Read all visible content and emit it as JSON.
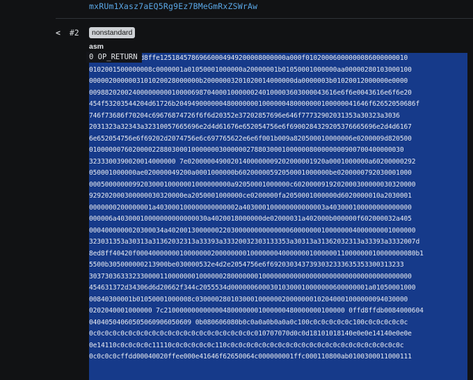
{
  "top_address": "mxRUm1Xasz7aEQ5Rg9Ez7BMeGmRxZSWrAw",
  "nav": {
    "back_label": "<",
    "index_label": "#2"
  },
  "badge": "nonstandard",
  "asm": {
    "label": "asm",
    "op_return": "0 OP_RETURN",
    "lines": [
      "ffd8ffe12518457869660004949200008000000a000f01020006000000086000000010",
      "0102001500000008c0000001a01050001000000a20000001b01050001000000aa00000280103000100",
      "0000020000003101020028000000b20000003201020014000000da0000003b01020012000000e0000",
      "009882020024000000000100006987040001000000240100003603000043616e6f6e0043616e6f6e20",
      "454f53203544204d61726b2049490000004800000001000000480000000100000041646f62652050686f",
      "746f73686f70204c69676874726f6f6d20352e37202857696e646f77732902031353a30323a3036",
      "2031323a32343a32310057665696e2d4d61676e652054756e6f6900284329205376665696e2d4d6167",
      "6e652054756e6f69202d2074756e6c697765622e6e6f001b009a820500010000006e0200009d820500",
      "01000000760200002288030001000000030000002788030001000000800000000900700400000030",
      "3233300390020014000000 7e02000004900201400000009202000001920a0001000000a60200000292",
      "050001000000ae020000049200a0001000000b60200000592050001000000be0200000792030001000",
      "000500000009920300010000001000000000a92050001000000c6020000919202000300000030320000",
      "929202000300000030320000ea2050001000000ce0200000fa2050001000000d6020000010a2030001",
      "0000000200000001a403000100000000000002a403000100000000000003a403000100000000000000",
      "000006a40300010000000000000030a4020018000000de02000031a402000b000000f602000032a405",
      "0004000000020300034a402001300000022030000000000000060000000100000004000000001000000",
      "323031353a30313a31362032313a33393a33320032303133353a30313a31362032313a33393a3332007d",
      "8ed8ff40420f00040000000100000002000000001000000040000000100000011000000010000000080b1",
      "5500b305000000213900be030000532e4d2e2054756e6f6920303437393032333635353300313233",
      "3037303633323300001100000001000000280000000100000000000000000000000000000000000000",
      "454631372d34306d6d20662f344c2055534d00000060003010300010000000600000001a01050001000",
      "00840300001b01050001000008c030000280103000100000020000000102040001000000094030000",
      "0202040001000000 7c2100000000000004800000001000000480000000100000 0ffd8ffdb0084000604",
      "04040504060505060906050609 0b080606080b0c0a0a0b0a0a0c100c0c0c0c0c0c100c0c0c0c0c0c",
      "0c0c0c0c0c0c0c0c0c0c0c0c0c0c0c0c0c0c0c0c0c010707070d0c0d18101018140e0e0e14140e0e0e",
      "0e14110c0c0c0c0c11110c0c0c0c0c0c110c0c0c0c0c0c0c0c0c0c0c0c0c0c0c0c0c0c0c0c0c0c0c",
      "0c0c0c0cffdd00040020ffee000e41646f62650064c000000001ffc000110800ab0100300011000111"
    ]
  }
}
